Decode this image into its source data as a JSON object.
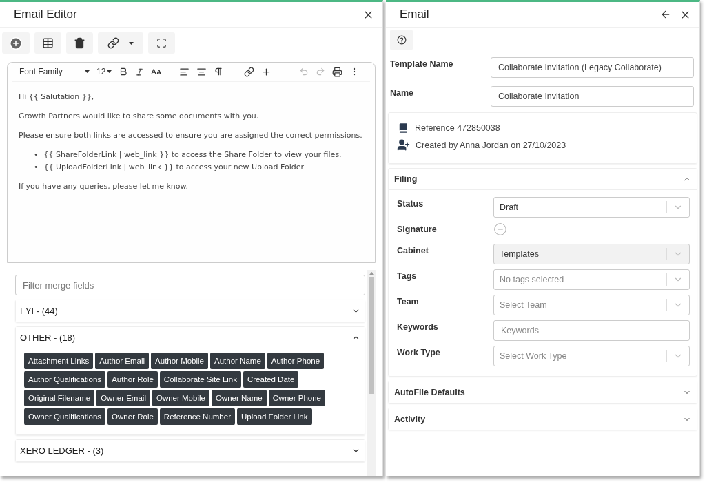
{
  "editor": {
    "title": "Email Editor",
    "format_toolbar": {
      "font_family": "Font Family",
      "font_size": "12"
    },
    "body": [
      {
        "kind": "paragraph",
        "text": "Hi {{ Salutation }},"
      },
      {
        "kind": "paragraph",
        "text": "Growth Partners would like to share some documents with you."
      },
      {
        "kind": "paragraph",
        "text": "Please ensure both links are accessed to ensure you are assigned the correct permissions."
      },
      {
        "kind": "bullets",
        "items": [
          {
            "marker": "•",
            "text": "{{ ShareFolderLink | web_link }} to access the Share Folder to view your files."
          },
          {
            "marker": "•",
            "text": "{{ UploadFolderLink | web_link }} to access your new Upload Folder"
          }
        ]
      },
      {
        "kind": "paragraph",
        "text": "If you have any queries, please let me know."
      }
    ],
    "merge_fields": {
      "placeholder": "Filter merge fields",
      "groups": [
        {
          "label": "FYI - (44)",
          "expanded": false
        },
        {
          "label": "OTHER - (18)",
          "expanded": true,
          "fields": [
            "Attachment Links",
            "Author Email",
            "Author Mobile",
            "Author Name",
            "Author Phone",
            "Author Qualifications",
            "Author Role",
            "Collaborate Site Link",
            "Created Date",
            "Original Filename",
            "Owner Email",
            "Owner Mobile",
            "Owner Name",
            "Owner Phone",
            "Owner Qualifications",
            "Owner Role",
            "Reference Number",
            "Upload Folder Link"
          ]
        },
        {
          "label": "XERO LEDGER - (3)",
          "expanded": false
        }
      ]
    }
  },
  "email": {
    "title": "Email",
    "fields": [
      {
        "label": "Template Name",
        "value": "Collaborate Invitation (Legacy Collaborate)"
      },
      {
        "label": "Name",
        "value": "Collaborate Invitation"
      }
    ],
    "info": [
      {
        "kind": "reference",
        "text": "Reference 472850038"
      },
      {
        "kind": "created",
        "text": "Created by Anna Jordan on 27/10/2023"
      }
    ],
    "sections": [
      {
        "title": "Filing",
        "expanded": true,
        "rows": [
          {
            "label": "Status",
            "kind": "select",
            "value": "Draft",
            "disabled": false
          },
          {
            "label": "Signature",
            "kind": "status"
          },
          {
            "label": "Cabinet",
            "kind": "select",
            "value": "Templates",
            "disabled": true
          },
          {
            "label": "Tags",
            "kind": "select",
            "placeholder": "No tags selected",
            "disabled": false
          },
          {
            "label": "Team",
            "kind": "select",
            "placeholder": "Select Team",
            "disabled": false
          },
          {
            "label": "Keywords",
            "kind": "input",
            "placeholder": "Keywords"
          },
          {
            "label": "Work Type",
            "kind": "select",
            "placeholder": "Select Work Type",
            "disabled": false
          }
        ]
      },
      {
        "title": "AutoFile Defaults",
        "expanded": false
      },
      {
        "title": "Activity",
        "expanded": false
      }
    ]
  }
}
